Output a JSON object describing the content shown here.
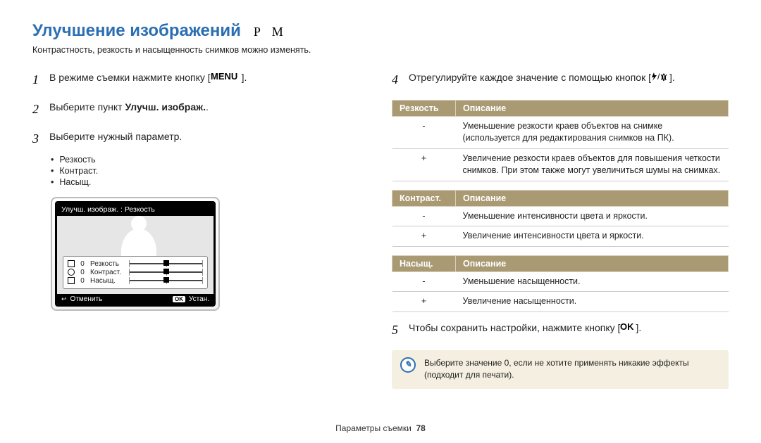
{
  "title": "Улучшение изображений",
  "modes": "P M",
  "subtitle": "Контрастность, резкость и насыщенность снимков можно изменять.",
  "steps": {
    "s1": "В режиме съемки нажмите кнопку [",
    "s1_end": "].",
    "s2_a": "Выберите пункт ",
    "s2_b": "Улучш. изображ.",
    "s2_c": ".",
    "s3": "Выберите нужный параметр.",
    "s4": "Отрегулируйте каждое значение с помощью кнопок [",
    "s4_end": "].",
    "s5": "Чтобы сохранить настройки, нажмите кнопку [",
    "s5_end": "]."
  },
  "bullets": [
    "Резкость",
    "Контраст.",
    "Насыщ."
  ],
  "lcd": {
    "top": "Улучш. изображ. : Резкость",
    "rows": {
      "r1": "Резкость",
      "r2": "Контраст.",
      "r3": "Насыщ.",
      "val": "0"
    },
    "cancel": "Отменить",
    "set": "Устан."
  },
  "tables": {
    "t1": {
      "h1": "Резкость",
      "h2": "Описание",
      "r1k": "-",
      "r1v": "Уменьшение резкости краев объектов на снимке (используется для редактирования снимков на ПК).",
      "r2k": "+",
      "r2v": "Увеличение резкости краев объектов для повышения четкости снимков. При этом также могут увеличиться шумы на снимках."
    },
    "t2": {
      "h1": "Контраст.",
      "h2": "Описание",
      "r1k": "-",
      "r1v": "Уменьшение интенсивности цвета и яркости.",
      "r2k": "+",
      "r2v": "Увеличение интенсивности цвета и яркости."
    },
    "t3": {
      "h1": "Насыщ.",
      "h2": "Описание",
      "r1k": "-",
      "r1v": "Уменьшение насыщенности.",
      "r2k": "+",
      "r2v": "Увеличение насыщенности."
    }
  },
  "note": "Выберите значение 0, если не хотите применять никакие эффекты (подходит для печати).",
  "footer_label": "Параметры съемки",
  "footer_page": "78"
}
